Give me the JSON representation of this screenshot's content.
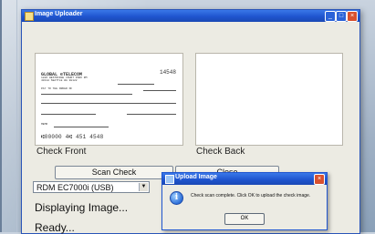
{
  "window": {
    "title": "Image Uploader",
    "controls": {
      "minimize": "_",
      "maximize": "□",
      "close": "×"
    }
  },
  "panels": {
    "front_caption": "Check Front",
    "back_caption": "Check Back"
  },
  "check": {
    "bank_name": "GLOBAL eTELECOM",
    "address": "1826 WESTRIDGE COURT PARK RM 4011A SEATTLE WA 98122",
    "check_number": "14548",
    "pay_to_label": "PAY TO THE ORDER OF",
    "memo_label": "MEMO",
    "micr_line": "⑆00000 4⑆ 451 4548"
  },
  "buttons": {
    "scan": "Scan Check",
    "close": "Close"
  },
  "scanner_select": {
    "value": "RDM EC7000i (USB)"
  },
  "status": {
    "line1": "Displaying Image...",
    "line2": "Ready..."
  },
  "dialog": {
    "title": "Upload Image",
    "message": "Check scan complete. Click OK to upload the check image.",
    "ok_label": "OK"
  }
}
